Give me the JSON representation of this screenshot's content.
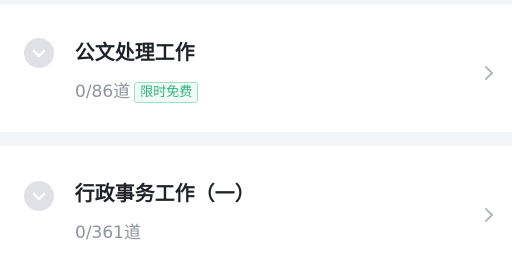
{
  "list": {
    "items": [
      {
        "title": "公文处理工作",
        "count": "0/86道",
        "badge": "限时免费",
        "toggle_icon": "chevron-down-icon",
        "arrow_icon": "chevron-right-icon"
      },
      {
        "title": "行政事务工作（一）",
        "count": "0/361道",
        "toggle_icon": "chevron-down-icon",
        "arrow_icon": "chevron-right-icon"
      }
    ]
  },
  "colors": {
    "background": "#f4f5f7",
    "card": "#ffffff",
    "title": "#1f2329",
    "muted": "#8f959e",
    "badge_text": "#2eb67d",
    "badge_border": "#9ee0c4",
    "toggle_bg": "#dfe1e6"
  }
}
